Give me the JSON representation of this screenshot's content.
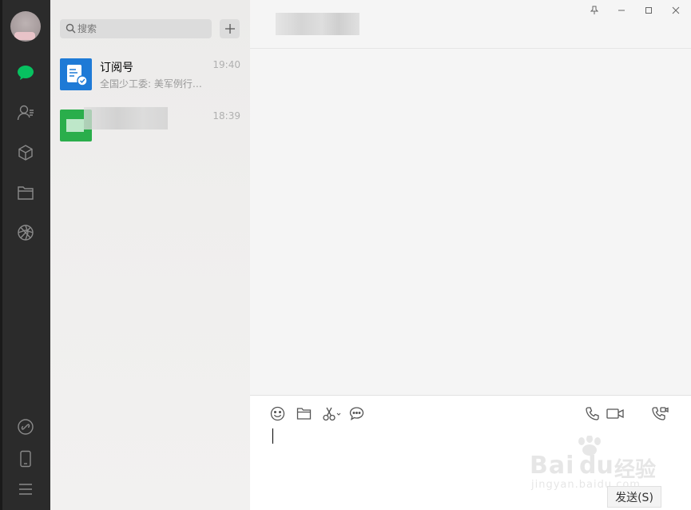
{
  "sidebar": {
    "icons": [
      "chat-icon",
      "contacts-icon",
      "favorites-icon",
      "files-icon",
      "moments-icon",
      "miniprogram-icon",
      "phone-icon",
      "menu-icon"
    ],
    "accent_color": "#07c160"
  },
  "chat_list": {
    "search_placeholder": "搜索",
    "add_label": "+",
    "items": [
      {
        "name": "订阅号",
        "time": "19:40",
        "preview": "全国少工委: 美军例行轰...",
        "icon": "subscription-icon",
        "color": "#1e7ad6"
      },
      {
        "name": "",
        "time": "18:39",
        "preview": "",
        "icon": "group-avatar",
        "color": "#2aae4b"
      }
    ]
  },
  "chat": {
    "title": "",
    "send_label": "发送(S)"
  },
  "watermark": {
    "brand": "Bai",
    "brand2": "du",
    "cn": "经验",
    "url": "jingyan.baidu.com"
  }
}
